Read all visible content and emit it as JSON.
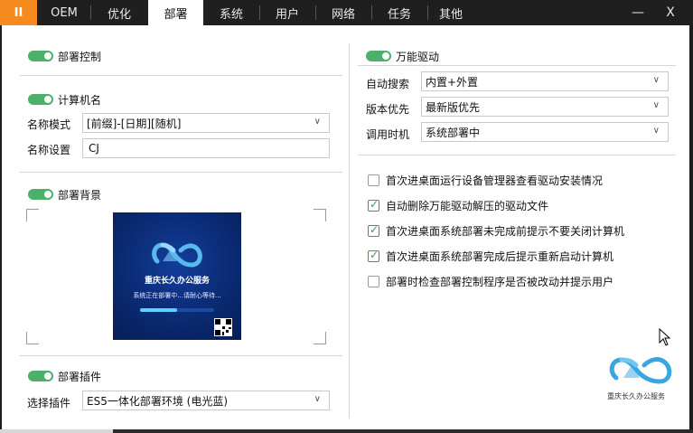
{
  "tabs": {
    "pause": "II",
    "items": [
      "OEM",
      "优化",
      "部署",
      "系统",
      "用户",
      "网络",
      "任务",
      "其他"
    ],
    "active_index": 2,
    "minimize": "—",
    "close": "X"
  },
  "left": {
    "deploy_control": {
      "label": "部署控制",
      "enabled": true
    },
    "computer_name": {
      "label": "计算机名",
      "enabled": true,
      "mode_label": "名称模式",
      "mode_value": "[前缀]-[日期][随机]",
      "setting_label": "名称设置",
      "setting_value": "CJ"
    },
    "background": {
      "label": "部署背景",
      "enabled": true,
      "preview_title": "重庆长久办公服务",
      "preview_subtitle": "系统正在部署中...请耐心等待...",
      "progress": 0.5
    },
    "plugin": {
      "label": "部署插件",
      "enabled": true,
      "select_label": "选择插件",
      "select_value": "ES5一体化部署环境 (电光蓝)"
    }
  },
  "right": {
    "driver": {
      "label": "万能驱动",
      "enabled": true,
      "auto_search_label": "自动搜索",
      "auto_search_value": "内置+外置",
      "version_label": "版本优先",
      "version_value": "最新版优先",
      "call_time_label": "调用时机",
      "call_time_value": "系统部署中"
    },
    "options": [
      {
        "label": "首次进桌面运行设备管理器查看驱动安装情况",
        "checked": false
      },
      {
        "label": "自动删除万能驱动解压的驱动文件",
        "checked": true
      },
      {
        "label": "首次进桌面系统部署未完成前提示不要关闭计算机",
        "checked": true
      },
      {
        "label": "首次进桌面系统部署完成后提示重新启动计算机",
        "checked": true
      },
      {
        "label": "部署时检查部署控制程序是否被改动并提示用户",
        "checked": false
      }
    ],
    "brand_text": "重庆长久办公服务"
  },
  "colors": {
    "accent_orange": "#f58a1f",
    "toggle_green": "#4caf6a",
    "logo_blue": "#3aa6e0"
  }
}
